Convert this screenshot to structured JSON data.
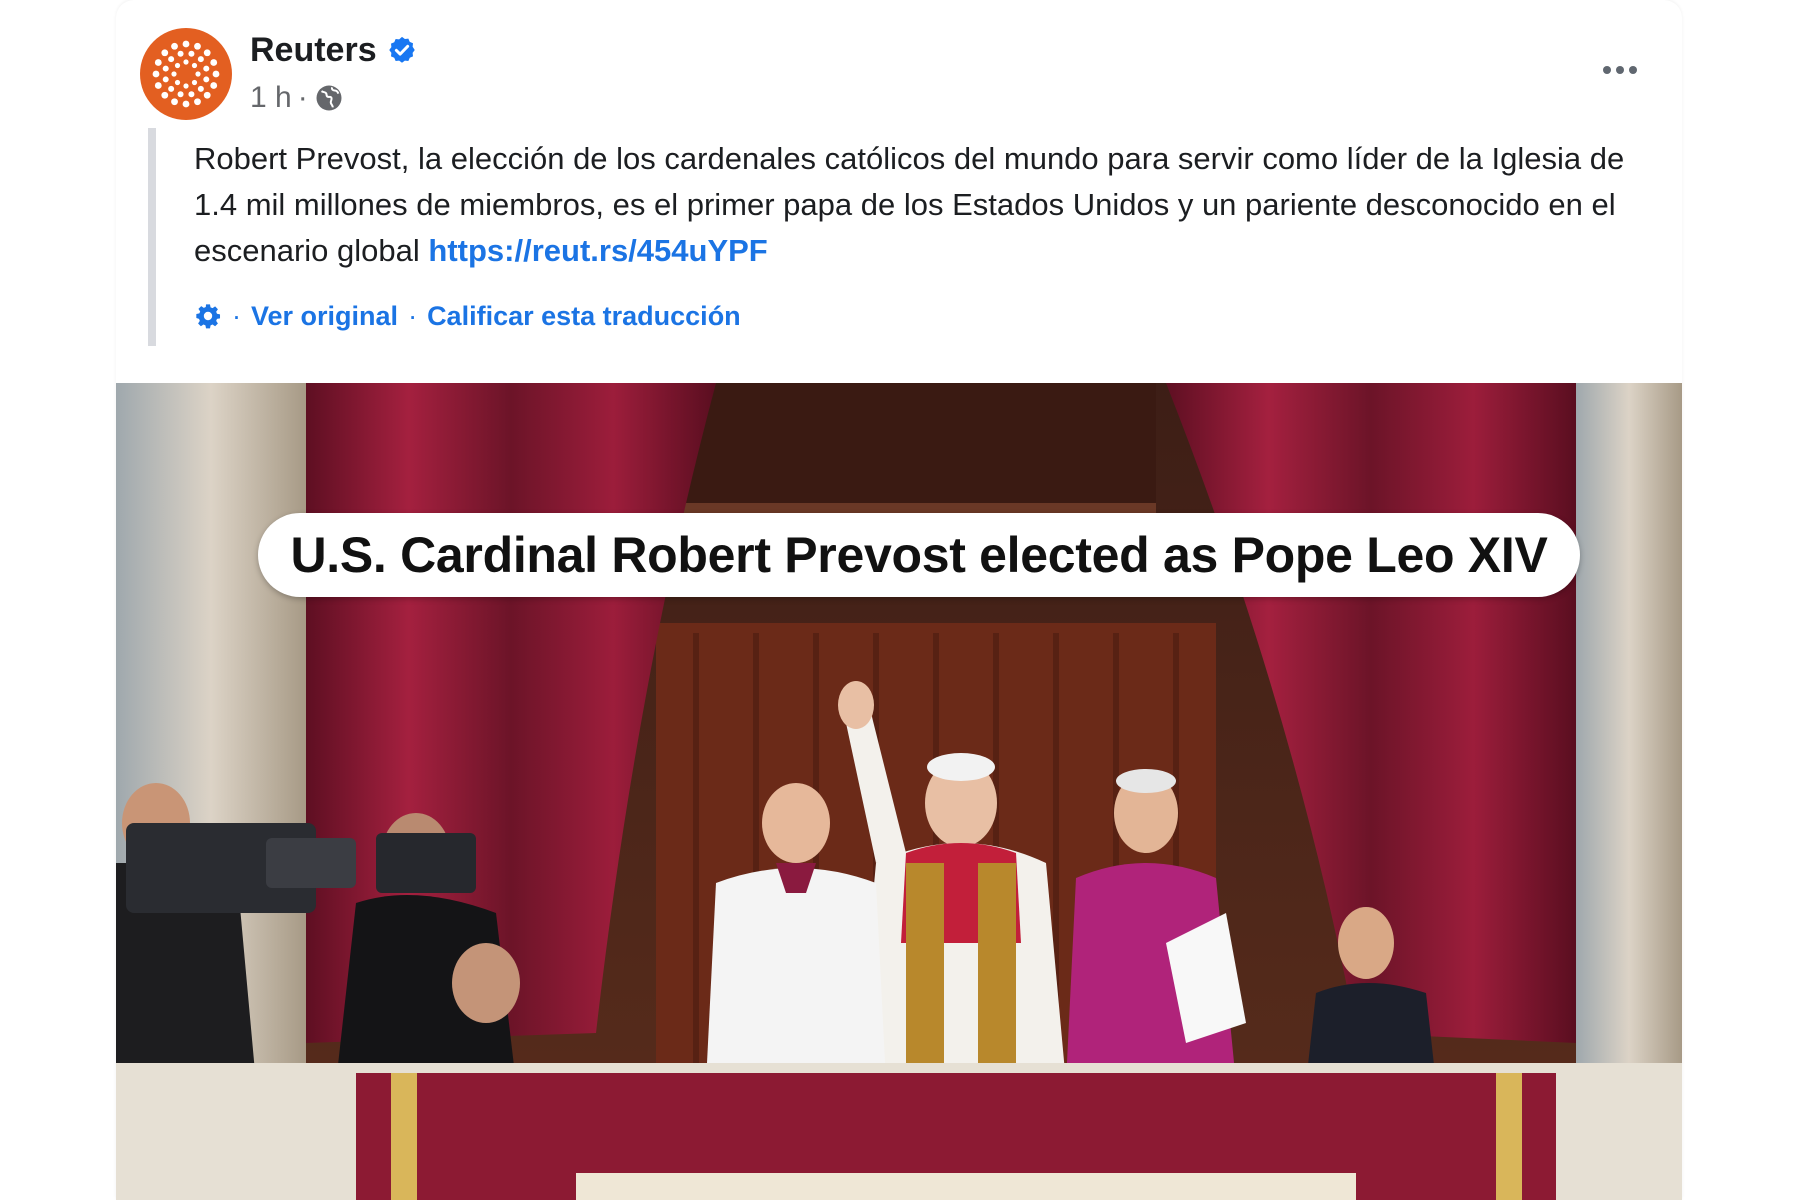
{
  "post": {
    "page_name": "Reuters",
    "verified_icon": "verified-badge-icon",
    "time": "1 h",
    "separator": "·",
    "audience_icon": "globe-icon",
    "more_icon": "more-options-icon",
    "text": "Robert Prevost, la elección de los cardenales católicos del mundo para servir como líder de la Iglesia de 1.4 mil millones de miembros, es el primer papa de los Estados Unidos y un pariente desconocido en el escenario global ",
    "link": "https://reut.rs/454uYPF"
  },
  "translation": {
    "settings_icon": "gear-icon",
    "sep": "·",
    "view_original": "Ver original",
    "rate": "Calificar esta traducción"
  },
  "media": {
    "caption": "U.S. Cardinal Robert Prevost elected as Pope Leo XIV"
  },
  "colors": {
    "brand": "#e35f21",
    "link": "#1b74e4",
    "verified": "#1877f2",
    "curtain": "#8b1a35"
  }
}
